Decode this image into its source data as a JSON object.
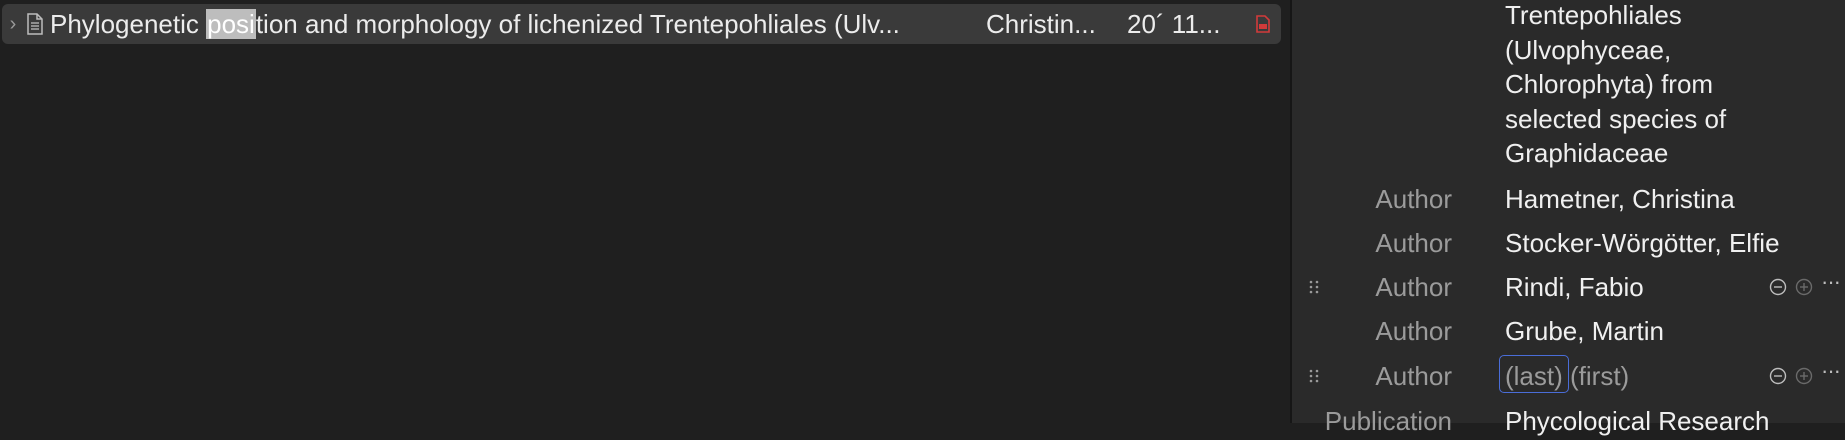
{
  "item": {
    "twisty": "›",
    "title_pre": "Phylogenetic ",
    "title_hl": "posi",
    "title_post": "tion and morphology of lichenized Trentepohliales (Ulv...",
    "creator": "Christin...",
    "date": "20´ 11..."
  },
  "info": {
    "title_lines": [
      "Trentepohliales",
      "(Ulvophyceae,",
      "Chlorophyta) from",
      "selected species of",
      "Graphidaceae"
    ],
    "authors": [
      {
        "label": "Author",
        "value": "Hametner, Christina"
      },
      {
        "label": "Author",
        "value": "Stocker-Wörgötter, Elfie"
      },
      {
        "label": "Author",
        "value": "Rindi, Fabio"
      },
      {
        "label": "Author",
        "value": "Grube, Martin"
      }
    ],
    "new_author": {
      "label": "Author",
      "last_placeholder": "(last)",
      "first_placeholder": "(first)"
    },
    "publication": {
      "label": "Publication",
      "value": "Phycological Research"
    },
    "more_glyph": "···"
  },
  "colors": {
    "accent": "#4a6dd8",
    "pdf": "#d23a3a"
  },
  "icons": [
    "chevron-right-icon",
    "document-icon",
    "pdf-icon",
    "grip-icon",
    "minus-circle-icon",
    "plus-circle-icon",
    "more-icon"
  ]
}
